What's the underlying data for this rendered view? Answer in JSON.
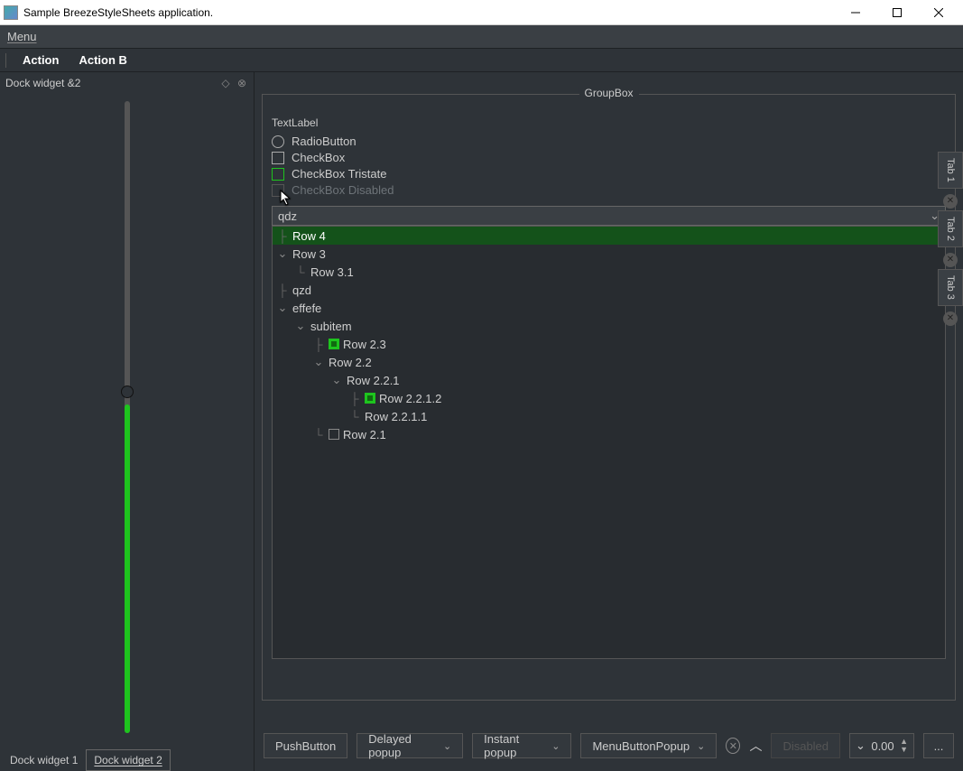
{
  "window": {
    "title": "Sample BreezeStyleSheets application."
  },
  "menubar": {
    "menu": "Menu"
  },
  "toolbar": {
    "action": "Action",
    "action_b": "Action B"
  },
  "dock": {
    "title": "Dock widget &2",
    "tabs": [
      "Dock widget 1",
      "Dock widget 2"
    ],
    "active_tab": 1,
    "slider": {
      "value": 0.48
    }
  },
  "groupbox": {
    "title": "GroupBox",
    "textlabel": "TextLabel",
    "radio": "RadioButton",
    "checkbox": "CheckBox",
    "checkbox_tri": "CheckBox Tristate",
    "checkbox_disabled": "CheckBox Disabled",
    "combo_value": "qdz"
  },
  "tree": [
    {
      "depth": 0,
      "label": "Row 4",
      "selected": true,
      "expander": "branch"
    },
    {
      "depth": 0,
      "label": "Row 3",
      "expander": "open"
    },
    {
      "depth": 1,
      "label": "Row 3.1",
      "expander": "leaf"
    },
    {
      "depth": 0,
      "label": "qzd",
      "expander": "branch"
    },
    {
      "depth": 0,
      "label": "effefe",
      "expander": "open"
    },
    {
      "depth": 1,
      "label": "subitem",
      "expander": "open"
    },
    {
      "depth": 2,
      "label": "Row 2.3",
      "expander": "branch",
      "check": "filled"
    },
    {
      "depth": 2,
      "label": "Row 2.2",
      "expander": "open"
    },
    {
      "depth": 3,
      "label": "Row 2.2.1",
      "expander": "open"
    },
    {
      "depth": 4,
      "label": "Row 2.2.1.2",
      "expander": "branch",
      "check": "filled"
    },
    {
      "depth": 4,
      "label": "Row 2.2.1.1",
      "expander": "leaf"
    },
    {
      "depth": 2,
      "label": "Row 2.1",
      "expander": "leaf",
      "check": "empty"
    }
  ],
  "bottombar": {
    "push": "PushButton",
    "delayed": "Delayed popup",
    "instant": "Instant popup",
    "menu": "MenuButtonPopup",
    "disabled": "Disabled",
    "spin": "0.00",
    "ellipsis": "..."
  },
  "right_tabs": [
    "Tab 1",
    "Tab 2",
    "Tab 3"
  ]
}
